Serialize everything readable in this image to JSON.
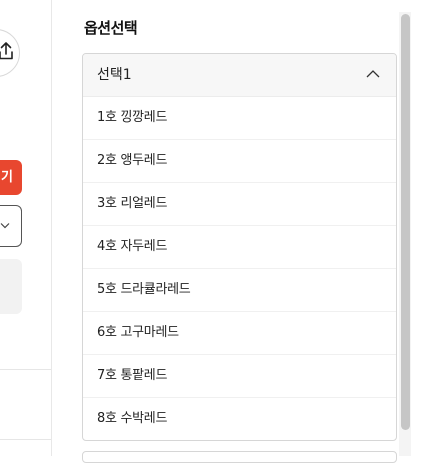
{
  "left_panel": {
    "buy_button_label": "기"
  },
  "option_selector": {
    "title": "옵션선택",
    "selected_label": "선택1",
    "items": [
      {
        "label": "1호 낑깡레드"
      },
      {
        "label": "2호 앵두레드"
      },
      {
        "label": "3호 리얼레드"
      },
      {
        "label": "4호 자두레드"
      },
      {
        "label": "5호 드라큘라레드"
      },
      {
        "label": "6호 고구마레드"
      },
      {
        "label": "7호 통팥레드"
      },
      {
        "label": "8호 수박레드"
      }
    ]
  },
  "icons": {
    "share": "share-icon",
    "dropdown_open": "chevron-up-icon",
    "collapsed_select": "chevron-down-icon"
  },
  "colors": {
    "accent": "#e8472f",
    "border": "#d6d6d6",
    "header_bg": "#f7f7f7",
    "scroll_thumb": "#c6c6c6"
  }
}
